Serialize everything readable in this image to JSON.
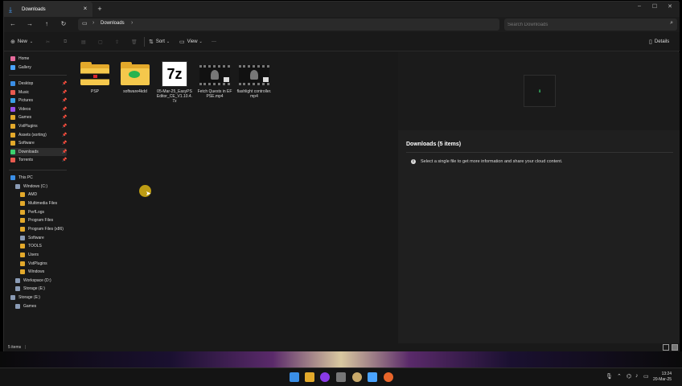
{
  "window": {
    "tab_title": "Downloads",
    "tab_close": "×",
    "new_tab": "+"
  },
  "address": {
    "breadcrumb": "Downloads",
    "separator": "›",
    "search_placeholder": "Search Downloads"
  },
  "toolbar": {
    "new_label": "New",
    "sort_label": "Sort",
    "view_label": "View",
    "more_label": "···",
    "details_label": "Details"
  },
  "sidebar": {
    "quick": [
      {
        "label": "Home",
        "color": "#e66b9c"
      },
      {
        "label": "Gallery",
        "color": "#4aa3ff"
      }
    ],
    "pinned": [
      {
        "label": "Desktop",
        "color": "#3a8ee6"
      },
      {
        "label": "Music",
        "color": "#e85a4f"
      },
      {
        "label": "Pictures",
        "color": "#3aa0e6"
      },
      {
        "label": "Videos",
        "color": "#9a4fe8"
      },
      {
        "label": "Games",
        "color": "#e3a92b"
      },
      {
        "label": "VstPlugins",
        "color": "#e3a92b"
      },
      {
        "label": "Assets (sorting)",
        "color": "#e3a92b"
      },
      {
        "label": "Software",
        "color": "#e3a92b"
      },
      {
        "label": "Downloads",
        "color": "#3bd16f"
      },
      {
        "label": "Torrents",
        "color": "#e85a4f"
      }
    ],
    "tree": [
      {
        "label": "This PC",
        "color": "#3a8ee6",
        "indent": 0
      },
      {
        "label": "Windows (C:)",
        "color": "#8a9bb5",
        "indent": 1
      },
      {
        "label": "AMD",
        "color": "#e3a92b",
        "indent": 2
      },
      {
        "label": "Multimedia Files",
        "color": "#e3a92b",
        "indent": 2
      },
      {
        "label": "PerfLogs",
        "color": "#e3a92b",
        "indent": 2
      },
      {
        "label": "Program Files",
        "color": "#e3a92b",
        "indent": 2
      },
      {
        "label": "Program Files (x86)",
        "color": "#e3a92b",
        "indent": 2
      },
      {
        "label": "Software",
        "color": "#8a9bb5",
        "indent": 2
      },
      {
        "label": "TOOLS",
        "color": "#e3a92b",
        "indent": 2
      },
      {
        "label": "Users",
        "color": "#e3a92b",
        "indent": 2
      },
      {
        "label": "VstPlugins",
        "color": "#e3a92b",
        "indent": 2
      },
      {
        "label": "Windows",
        "color": "#e3a92b",
        "indent": 2
      },
      {
        "label": "Workspace (D:)",
        "color": "#8a9bb5",
        "indent": 1
      },
      {
        "label": "Storage (E:)",
        "color": "#8a9bb5",
        "indent": 1
      },
      {
        "label": "Storage (E:)",
        "color": "#8a9bb5",
        "indent": 0
      },
      {
        "label": "Games",
        "color": "#8a9bb5",
        "indent": 1
      }
    ]
  },
  "files": [
    {
      "name": "PSP",
      "kind": "folder-red"
    },
    {
      "name": "software4kdd",
      "kind": "folder-green"
    },
    {
      "name": "05-Mar-25_EasyPSEditor_CE_V1.10.4.7z",
      "kind": "7z",
      "icon_text": "7z"
    },
    {
      "name": "Fetch Quests in EFPSE.mp4",
      "kind": "video"
    },
    {
      "name": "flashlight controller.mp4",
      "kind": "video"
    }
  ],
  "details": {
    "title": "Downloads (5 items)",
    "message": "Select a single file to get more information and share your cloud content."
  },
  "status": {
    "count": "5 items",
    "separator": "|"
  },
  "taskbar": {
    "time": "13:24",
    "date": "20-Mar-25"
  }
}
